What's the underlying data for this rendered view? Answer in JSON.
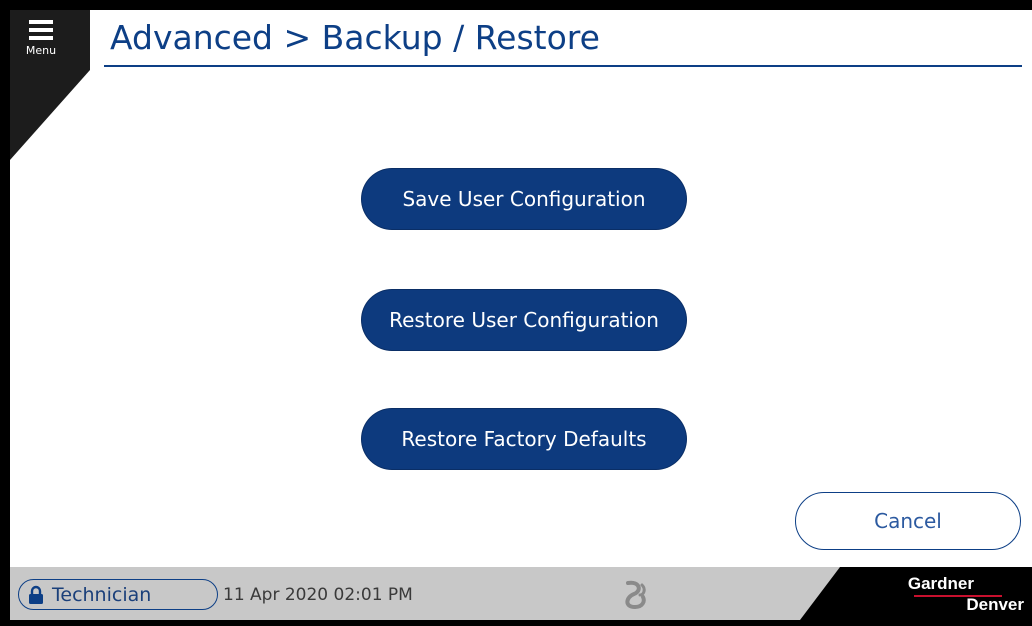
{
  "menu": {
    "label": "Menu",
    "icon": "hamburger-icon"
  },
  "header": {
    "title": "Advanced > Backup / Restore"
  },
  "actions": {
    "save_user_config": "Save User Configuration",
    "restore_user_config": "Restore User Configuration",
    "restore_factory_defaults": "Restore Factory Defaults"
  },
  "cancel_label": "Cancel",
  "status": {
    "user_level": "Technician",
    "user_icon": "lock-icon",
    "datetime": "11 Apr 2020  02:01 PM",
    "center_icon": "swirl-logo-icon"
  },
  "brand": {
    "line1": "Gardner",
    "line2": "Denver"
  },
  "colors": {
    "primary": "#0d3a7e",
    "title": "#0d3f86",
    "status_bar": "#c8c8c8",
    "brand_red": "#c8102e"
  }
}
